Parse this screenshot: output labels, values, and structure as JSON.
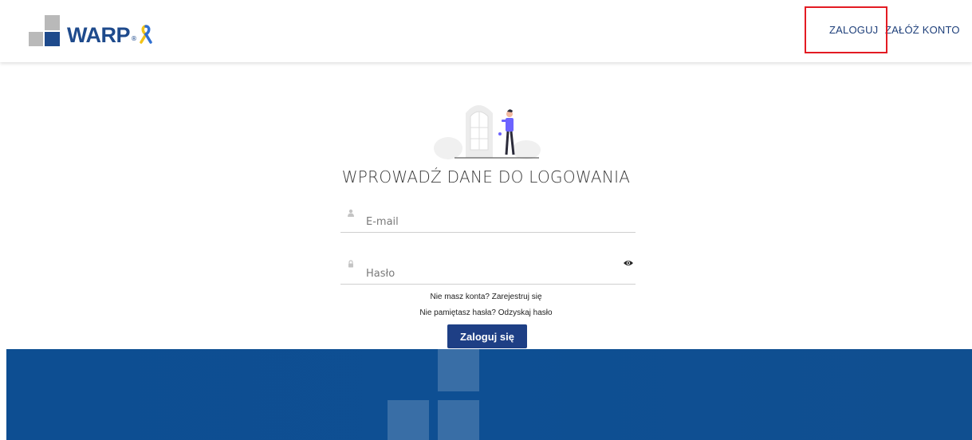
{
  "header": {
    "logo_text": "WARP",
    "logo_reg": "®",
    "nav_login": "ZALOGUJ",
    "nav_register": "ZAŁÓŻ KONTO"
  },
  "login": {
    "title": "WPROWADŹ DANE DO LOGOWANIA",
    "email_placeholder": "E-mail",
    "password_placeholder": "Hasło",
    "no_account_text": "Nie masz konta? Zarejestruj się",
    "forgot_text": "Nie pamiętasz hasła? Odzyskaj hasło",
    "submit_label": "Zaloguj się"
  },
  "icons": {
    "email": "user-icon",
    "password": "lock-icon",
    "reveal": "eye-icon"
  },
  "colors": {
    "brand": "#1e4a8c",
    "button": "#1e3f85",
    "band": "#0d4e92",
    "highlight": "#e31b23"
  }
}
